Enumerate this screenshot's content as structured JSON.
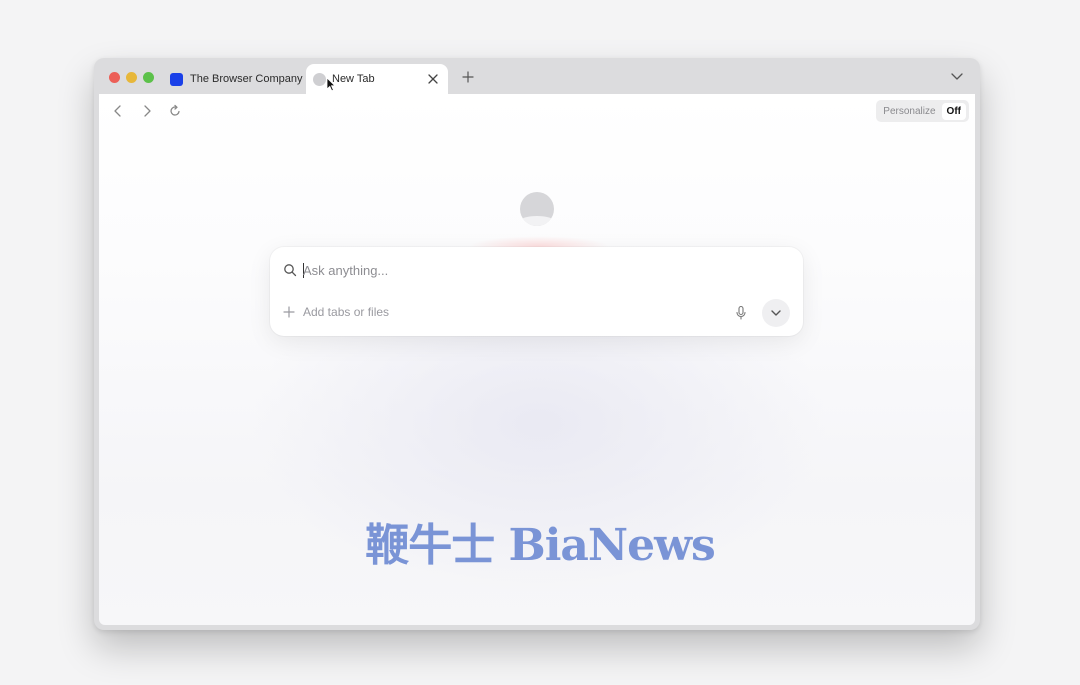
{
  "tabs": [
    {
      "label": "The Browser Company",
      "favicon": "browser-company-logo",
      "active": false
    },
    {
      "label": "New Tab",
      "favicon": "new-tab-globe-icon",
      "active": true
    }
  ],
  "toolbar": {
    "personalize_label": "Personalize",
    "personalize_state": "Off"
  },
  "search": {
    "placeholder": "Ask anything...",
    "value": "",
    "add_context_label": "Add tabs or files"
  },
  "watermark": {
    "text": "鞭牛士 BiaNews"
  },
  "colors": {
    "accent_blue": "#1a40e8",
    "watermark": "#7a94d6",
    "traffic_red": "#ec5f57",
    "traffic_yellow": "#e7b73a",
    "traffic_green": "#5cc14a"
  }
}
